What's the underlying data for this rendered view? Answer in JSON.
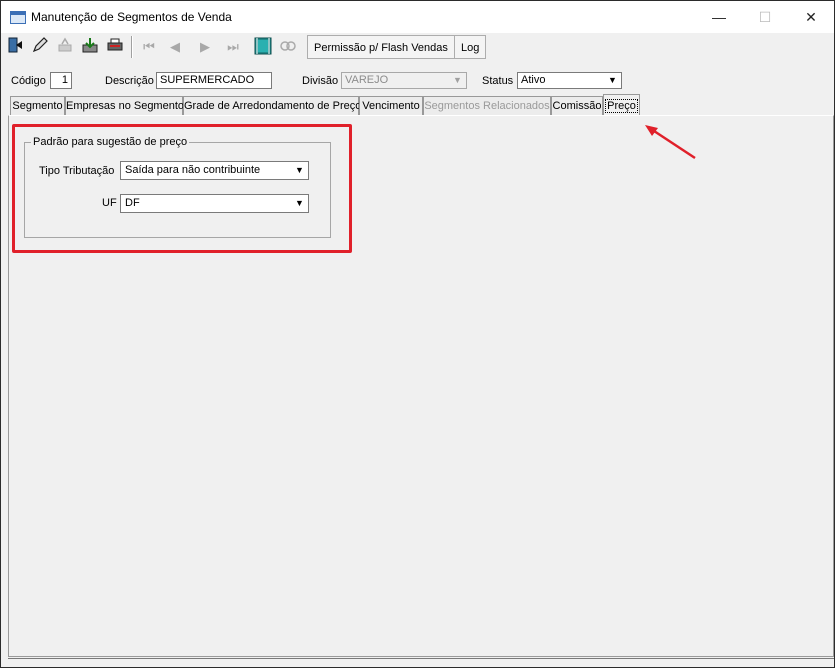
{
  "window": {
    "title": "Manutenção de Segmentos de Venda",
    "controls": {
      "minimize": "—",
      "maximize": "☐",
      "close": "✕"
    }
  },
  "toolbar": {
    "icons": [
      "exit-icon",
      "edit-icon",
      "delete-icon",
      "save-icon",
      "print-icon",
      "first-icon",
      "prev-icon",
      "next-icon",
      "last-icon",
      "grid-icon",
      "search-icon"
    ],
    "buttons": {
      "flash": "Permissão p/ Flash Vendas",
      "log": "Log"
    }
  },
  "fields": {
    "codigo_label": "Código",
    "codigo_value": "1",
    "descricao_label": "Descrição",
    "descricao_value": "SUPERMERCADO",
    "divisao_label": "Divisão",
    "divisao_value": "VAREJO",
    "status_label": "Status",
    "status_value": "Ativo"
  },
  "tabs": [
    {
      "label": "Segmento"
    },
    {
      "label": "Empresas no Segmento"
    },
    {
      "label": "Grade de Arredondamento de Preço"
    },
    {
      "label": "Vencimento"
    },
    {
      "label": "Segmentos Relacionados",
      "disabled": true
    },
    {
      "label": "Comissão"
    },
    {
      "label": "Preço",
      "active": true
    }
  ],
  "preco": {
    "group_title": "Padrão para sugestão de preço",
    "tipo_label": "Tipo Tributação",
    "tipo_value": "Saída para não contribuinte",
    "uf_label": "UF",
    "uf_value": "DF"
  },
  "colors": {
    "highlight": "#e0202a",
    "arrow": "#e0202a"
  }
}
